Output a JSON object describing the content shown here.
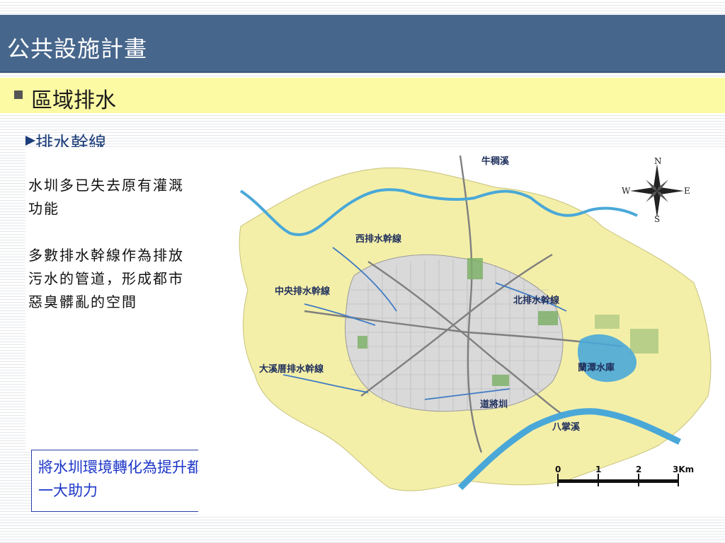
{
  "slide": {
    "title": "公共設施計畫",
    "subtitle": "區域排水",
    "section": "排水幹線"
  },
  "body": {
    "paragraphs": [
      "水圳多已失去原有灌溉功能",
      "多數排水幹線作為排放污水的管道，形成都市惡臭髒亂的空間"
    ],
    "callout": "將水圳環境轉化為提升都市生態景觀的一大助力"
  },
  "map": {
    "labels": {
      "niu_chou_creek": "牛稠溪",
      "west_main": "西排水幹線",
      "central_main": "中央排水幹線",
      "north_main": "北排水幹線",
      "daxi_main": "大溪厝排水幹線",
      "lantan_reservoir": "蘭潭水庫",
      "daojiang_canal": "道將圳",
      "bazhang_creek": "八掌溪"
    },
    "compass": {
      "n": "N",
      "s": "S",
      "e": "E",
      "w": "W"
    },
    "scale_bar": {
      "ticks": [
        "0",
        "1",
        "2",
        "3Km"
      ]
    },
    "colors": {
      "land": "#f4efa8",
      "urban": "#d9d9d9",
      "water": "#4aa8d8",
      "green": "#7fb16a",
      "road": "#8c8c8c",
      "canal": "#3e7bc4"
    }
  }
}
